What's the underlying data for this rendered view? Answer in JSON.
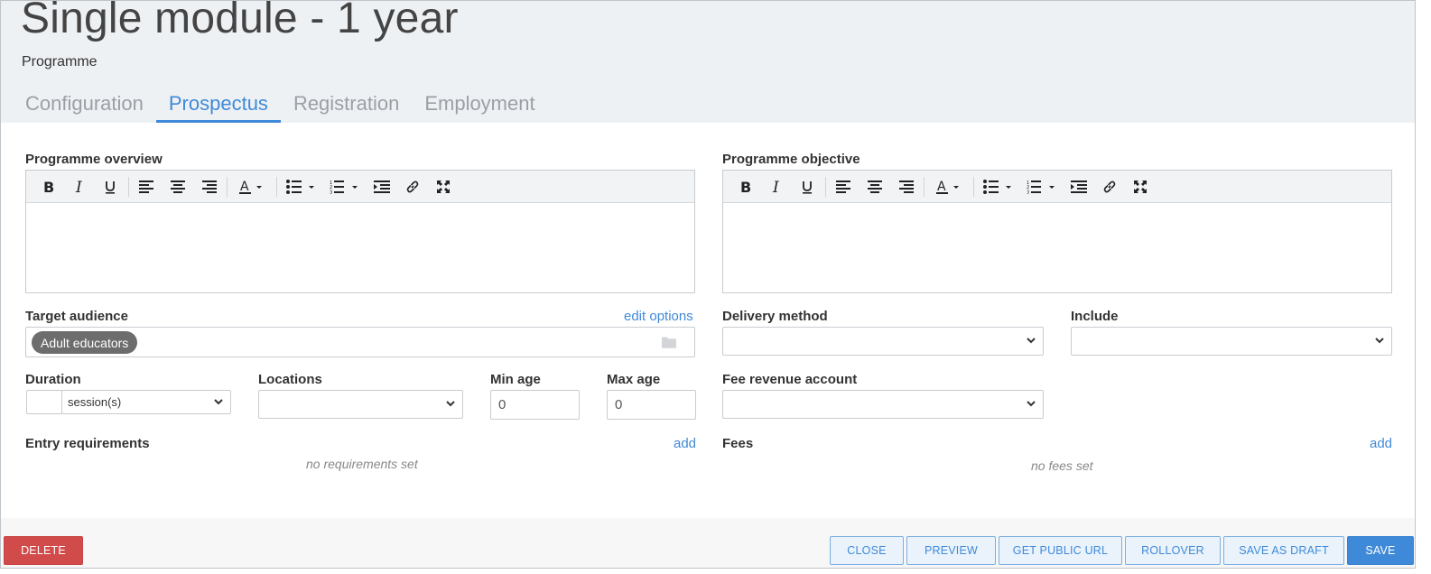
{
  "page": {
    "title": "Single module - 1 year",
    "subtitle": "Programme"
  },
  "tabs": [
    {
      "label": "Configuration",
      "active": false
    },
    {
      "label": "Prospectus",
      "active": true
    },
    {
      "label": "Registration",
      "active": false
    },
    {
      "label": "Employment",
      "active": false
    }
  ],
  "toolbar_icons": [
    "bold-icon",
    "italic-icon",
    "underline-icon",
    "align-left-icon",
    "align-center-icon",
    "align-right-icon",
    "text-color-icon",
    "bullet-list-icon",
    "numbered-list-icon",
    "indent-icon",
    "link-icon",
    "fullscreen-icon"
  ],
  "overview": {
    "label": "Programme overview",
    "value": ""
  },
  "objective": {
    "label": "Programme objective",
    "value": ""
  },
  "target_audience": {
    "label": "Target audience",
    "edit_link": "edit options",
    "tags": [
      "Adult educators"
    ]
  },
  "delivery_method": {
    "label": "Delivery method",
    "value": ""
  },
  "include": {
    "label": "Include",
    "value": ""
  },
  "duration": {
    "label": "Duration",
    "value": "",
    "unit": "session(s)"
  },
  "locations": {
    "label": "Locations",
    "value": ""
  },
  "min_age": {
    "label": "Min age",
    "value": "0"
  },
  "max_age": {
    "label": "Max age",
    "value": "0"
  },
  "fee_revenue_account": {
    "label": "Fee revenue account",
    "value": ""
  },
  "entry_requirements": {
    "label": "Entry requirements",
    "add_link": "add",
    "empty_text": "no requirements set"
  },
  "fees": {
    "label": "Fees",
    "add_link": "add",
    "empty_text": "no fees set"
  },
  "footer": {
    "delete": "DELETE",
    "close": "CLOSE",
    "preview": "PREVIEW",
    "get_public_url": "GET PUBLIC URL",
    "rollover": "ROLLOVER",
    "save_as_draft": "SAVE AS DRAFT",
    "save": "SAVE"
  },
  "colors": {
    "accent": "#3f8ad8",
    "danger": "#d24b4b",
    "header_bg": "#eef1f4",
    "tag_bg": "#6d6d6d"
  }
}
